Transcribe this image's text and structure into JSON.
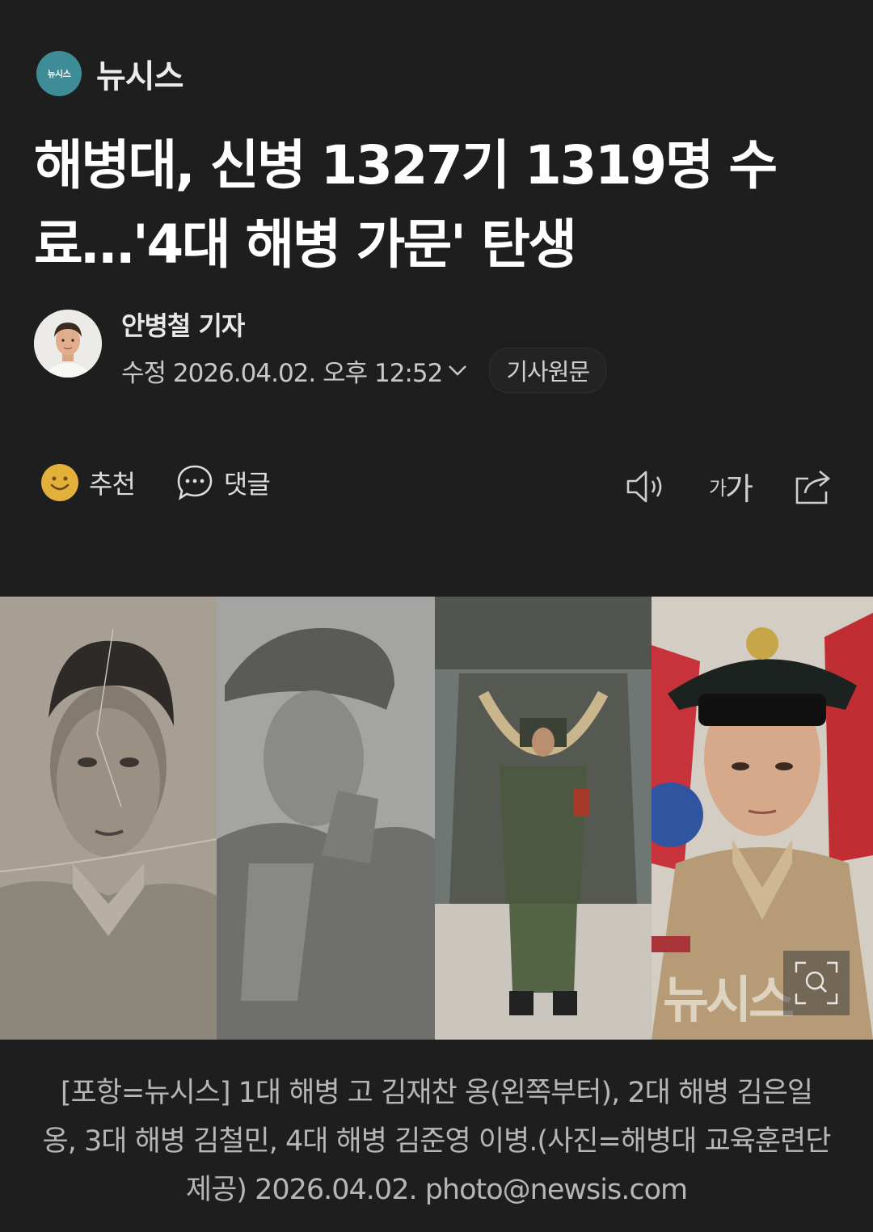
{
  "press": {
    "logo_text": "뉴시스",
    "name": "뉴시스"
  },
  "article": {
    "title": "해병대, 신병 1327기 1319명 수료…'4대 해병 가문' 탄생",
    "author": "안병철 기자",
    "timestamp": "수정 2026.04.02. 오후 12:52",
    "original_button": "기사원문"
  },
  "actions": {
    "recommend": "추천",
    "comment": "댓글"
  },
  "tools": {
    "font_small": "가",
    "font_large": "가"
  },
  "photo": {
    "watermark": "뉴시스"
  },
  "caption": "[포항=뉴시스] 1대 해병 고 김재찬 옹(왼쪽부터), 2대 해병 김은일 옹, 3대 해병 김철민, 4대 해병 김준영 이병.(사진=해병대 교육훈련단 제공) 2026.04.02. photo@newsis.com",
  "colors": {
    "background": "#1e1e1f",
    "press_logo": "#3f8c99",
    "emoji": "#e3b13a"
  }
}
